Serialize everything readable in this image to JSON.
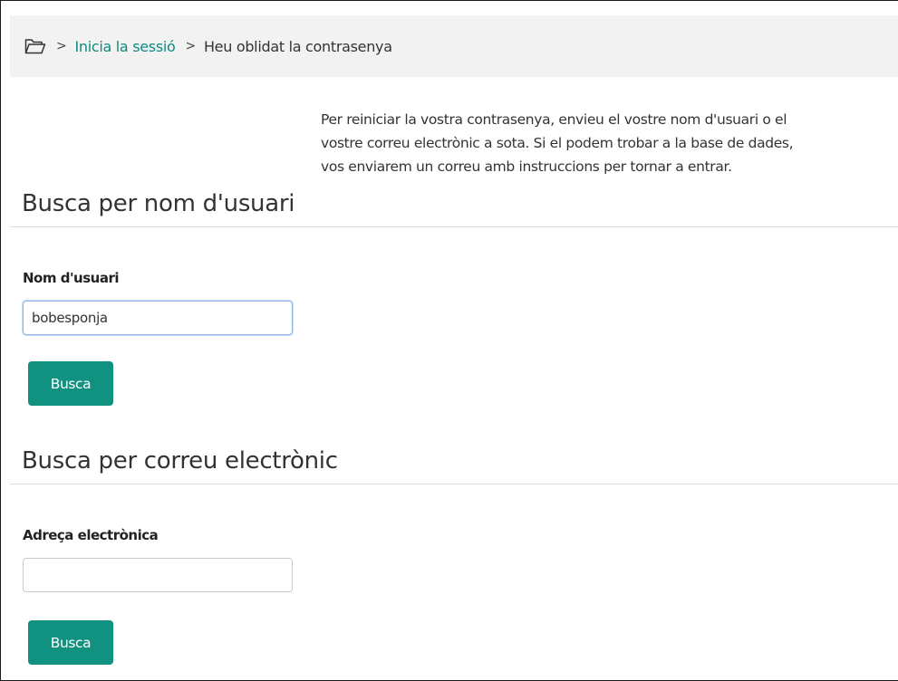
{
  "breadcrumb": {
    "icon": "folder-icon",
    "items": [
      {
        "label": "Inicia la sessió",
        "link": true
      },
      {
        "label": "Heu oblidat la contrasenya",
        "link": false
      }
    ],
    "separator": ">"
  },
  "intro": {
    "lines": [
      "Per reiniciar la vostra contrasenya, envieu el vostre nom d'usuari o el",
      "vostre correu electrònic a sota. Si el podem trobar a la base de dades,",
      "vos enviarem un correu amb instruccions per tornar a entrar."
    ]
  },
  "username_section": {
    "title": "Busca per nom d'usuari",
    "field_label": "Nom d'usuari",
    "field_value": "bobesponja",
    "button_label": "Busca"
  },
  "email_section": {
    "title": "Busca per correu electrònic",
    "field_label": "Adreça electrònica",
    "field_value": "",
    "button_label": "Busca"
  },
  "colors": {
    "accent": "#11917f",
    "link": "#0f8a80",
    "breadcrumb_bg": "#f2f2f2"
  }
}
